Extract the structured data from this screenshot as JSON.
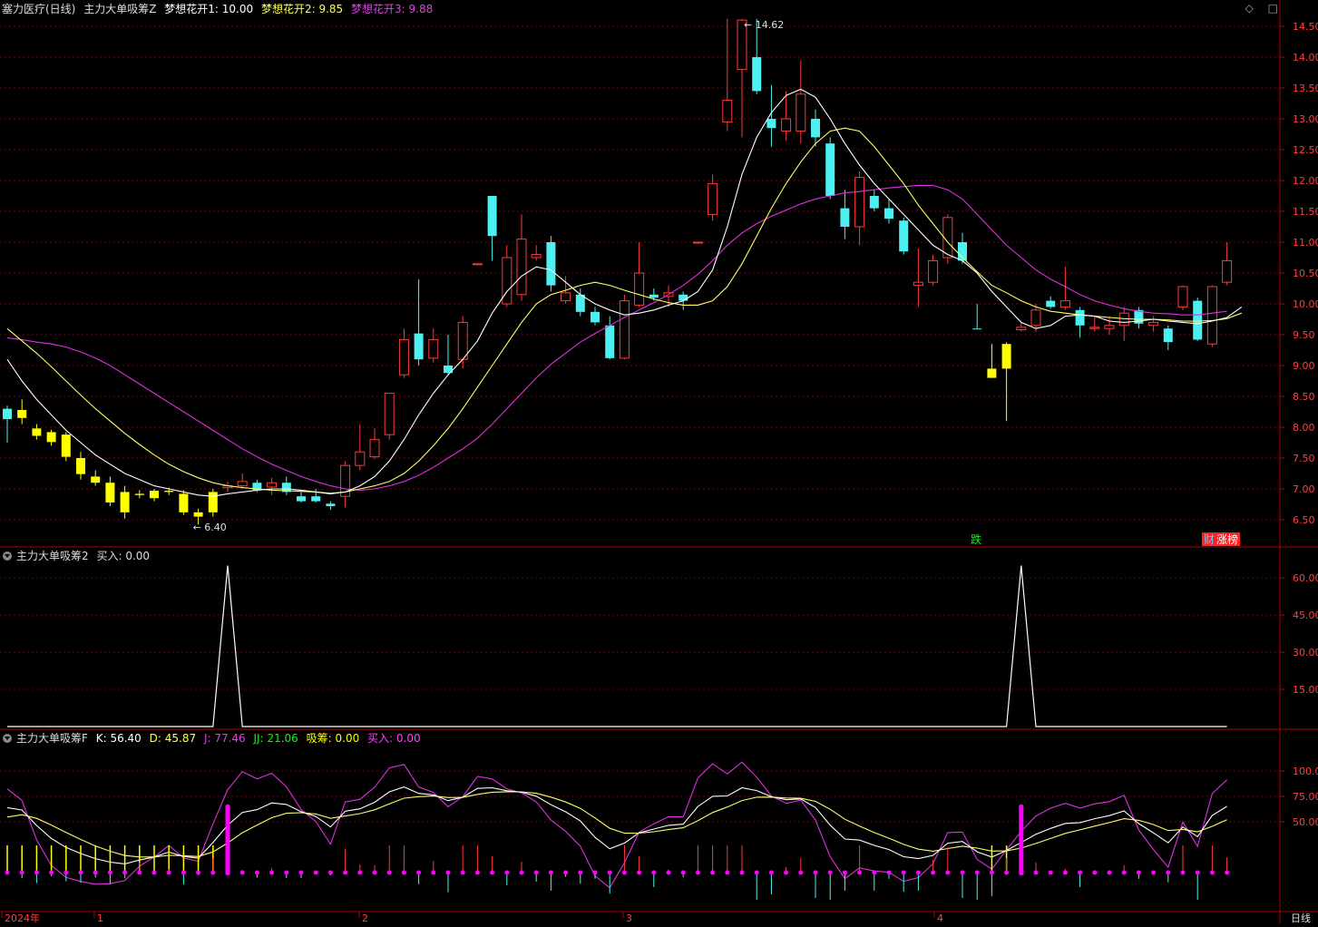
{
  "main_panel": {
    "stock_title": "塞力医疗(日线)",
    "indicator_name": "主力大单吸筹Z",
    "series1_label": "梦想花开1: 10.00",
    "series2_label": "梦想花开2: 9.85",
    "series3_label": "梦想花开3: 9.88",
    "high_label": "14.62",
    "low_label": "6.40",
    "marker_die": "跌",
    "marker_cai": "财",
    "marker_zhangting": "涨榜",
    "y_ticks": [
      "14.50",
      "14.00",
      "13.50",
      "13.00",
      "12.50",
      "12.00",
      "11.50",
      "11.00",
      "10.50",
      "10.00",
      "9.50",
      "9.00",
      "8.50",
      "8.00",
      "7.50",
      "7.00",
      "6.50"
    ]
  },
  "panel2": {
    "name": "主力大单吸筹2",
    "buy_label": "买入: 0.00",
    "y_ticks": [
      "60.00",
      "45.00",
      "30.00",
      "15.00"
    ]
  },
  "panel3": {
    "name": "主力大单吸筹F",
    "k_label": "K: 56.40",
    "d_label": "D: 45.87",
    "j_label": "J: 77.46",
    "jj_label": "JJ: 21.06",
    "xichou_label": "吸筹: 0.00",
    "buy_label": "买入: 0.00",
    "y_ticks": [
      "100.0",
      "75.00",
      "50.00"
    ]
  },
  "x_axis": {
    "labels": [
      "2024年",
      "1",
      "2",
      "3",
      "4"
    ],
    "period": "日线"
  },
  "colors": {
    "up": "#ff3a3a",
    "down": "#4cf0f0",
    "yellow_candle": "#ffff00",
    "ma_white": "#ffffff",
    "ma_yellow": "#ffff66",
    "ma_magenta": "#e030e0",
    "grid": "#7a0000",
    "axis": "#b00000",
    "magenta": "#ff00ff",
    "green_text": "#00ff00"
  },
  "chart_data": {
    "type": "candlestick",
    "price_range": [
      6.2,
      14.75
    ],
    "candles": [
      {
        "o": 8.13,
        "h": 8.35,
        "l": 7.75,
        "c": 8.3,
        "col": "down"
      },
      {
        "o": 8.28,
        "h": 8.45,
        "l": 8.05,
        "c": 8.15,
        "col": "yellow"
      },
      {
        "o": 7.98,
        "h": 8.05,
        "l": 7.8,
        "c": 7.86,
        "col": "yellow"
      },
      {
        "o": 7.92,
        "h": 7.96,
        "l": 7.7,
        "c": 7.76,
        "col": "yellow"
      },
      {
        "o": 7.88,
        "h": 7.92,
        "l": 7.45,
        "c": 7.52,
        "col": "yellow"
      },
      {
        "o": 7.5,
        "h": 7.6,
        "l": 7.15,
        "c": 7.24,
        "col": "yellow"
      },
      {
        "o": 7.2,
        "h": 7.3,
        "l": 7.05,
        "c": 7.1,
        "col": "yellow"
      },
      {
        "o": 7.1,
        "h": 7.2,
        "l": 6.72,
        "c": 6.78,
        "col": "yellow"
      },
      {
        "o": 6.95,
        "h": 7.05,
        "l": 6.52,
        "c": 6.62,
        "col": "yellow"
      },
      {
        "o": 6.92,
        "h": 6.98,
        "l": 6.85,
        "c": 6.9,
        "col": "yellow"
      },
      {
        "o": 6.97,
        "h": 7.0,
        "l": 6.8,
        "c": 6.85,
        "col": "yellow"
      },
      {
        "o": 6.97,
        "h": 7.02,
        "l": 6.9,
        "c": 6.95,
        "col": "yellow"
      },
      {
        "o": 6.92,
        "h": 6.98,
        "l": 6.58,
        "c": 6.62,
        "col": "yellow"
      },
      {
        "o": 6.62,
        "h": 6.68,
        "l": 6.42,
        "c": 6.55,
        "col": "yellow"
      },
      {
        "o": 6.62,
        "h": 7.0,
        "l": 6.55,
        "c": 6.95,
        "col": "yellow"
      },
      {
        "o": 7.02,
        "h": 7.12,
        "l": 6.95,
        "c": 7.05,
        "col": "up"
      },
      {
        "o": 7.05,
        "h": 7.25,
        "l": 7.0,
        "c": 7.12,
        "col": "up"
      },
      {
        "o": 7.1,
        "h": 7.15,
        "l": 6.95,
        "c": 6.98,
        "col": "down"
      },
      {
        "o": 7.03,
        "h": 7.18,
        "l": 6.9,
        "c": 7.1,
        "col": "up"
      },
      {
        "o": 7.1,
        "h": 7.2,
        "l": 6.9,
        "c": 6.95,
        "col": "down"
      },
      {
        "o": 6.88,
        "h": 6.95,
        "l": 6.78,
        "c": 6.8,
        "col": "down"
      },
      {
        "o": 6.88,
        "h": 7.0,
        "l": 6.78,
        "c": 6.8,
        "col": "down"
      },
      {
        "o": 6.76,
        "h": 6.8,
        "l": 6.66,
        "c": 6.72,
        "col": "down"
      },
      {
        "o": 6.88,
        "h": 7.45,
        "l": 6.7,
        "c": 7.38,
        "col": "up"
      },
      {
        "o": 7.38,
        "h": 8.05,
        "l": 7.3,
        "c": 7.6,
        "col": "up"
      },
      {
        "o": 7.52,
        "h": 7.98,
        "l": 7.48,
        "c": 7.8,
        "col": "up"
      },
      {
        "o": 7.88,
        "h": 8.55,
        "l": 7.8,
        "c": 8.55,
        "col": "up"
      },
      {
        "o": 8.85,
        "h": 9.6,
        "l": 8.8,
        "c": 9.42,
        "col": "up"
      },
      {
        "o": 9.52,
        "h": 10.4,
        "l": 9.0,
        "c": 9.1,
        "col": "down"
      },
      {
        "o": 9.12,
        "h": 9.6,
        "l": 9.05,
        "c": 9.42,
        "col": "up"
      },
      {
        "o": 9.0,
        "h": 9.5,
        "l": 8.85,
        "c": 8.88,
        "col": "down"
      },
      {
        "o": 9.1,
        "h": 9.8,
        "l": 8.95,
        "c": 9.7,
        "col": "up"
      },
      {
        "o": 10.65,
        "h": 10.65,
        "l": 10.65,
        "c": 10.65,
        "col": "up"
      },
      {
        "o": 11.75,
        "h": 11.75,
        "l": 10.7,
        "c": 11.1,
        "col": "down"
      },
      {
        "o": 10.0,
        "h": 10.95,
        "l": 9.95,
        "c": 10.75,
        "col": "up"
      },
      {
        "o": 10.15,
        "h": 11.45,
        "l": 10.05,
        "c": 11.05,
        "col": "up"
      },
      {
        "o": 10.75,
        "h": 10.95,
        "l": 10.7,
        "c": 10.8,
        "col": "up"
      },
      {
        "o": 11.0,
        "h": 11.1,
        "l": 10.2,
        "c": 10.3,
        "col": "down"
      },
      {
        "o": 10.05,
        "h": 10.45,
        "l": 10.0,
        "c": 10.18,
        "col": "up"
      },
      {
        "o": 10.15,
        "h": 10.25,
        "l": 9.8,
        "c": 9.87,
        "col": "down"
      },
      {
        "o": 9.87,
        "h": 9.95,
        "l": 9.65,
        "c": 9.7,
        "col": "down"
      },
      {
        "o": 9.65,
        "h": 9.8,
        "l": 9.1,
        "c": 9.12,
        "col": "down"
      },
      {
        "o": 9.12,
        "h": 10.15,
        "l": 9.1,
        "c": 10.05,
        "col": "up"
      },
      {
        "o": 9.98,
        "h": 11.0,
        "l": 9.95,
        "c": 10.5,
        "col": "up"
      },
      {
        "o": 10.15,
        "h": 10.25,
        "l": 10.05,
        "c": 10.1,
        "col": "down"
      },
      {
        "o": 10.12,
        "h": 10.3,
        "l": 9.95,
        "c": 10.18,
        "col": "up"
      },
      {
        "o": 10.15,
        "h": 10.2,
        "l": 9.9,
        "c": 10.05,
        "col": "down"
      },
      {
        "o": 11.0,
        "h": 11.0,
        "l": 11.0,
        "c": 11.0,
        "col": "up"
      },
      {
        "o": 11.45,
        "h": 12.1,
        "l": 11.35,
        "c": 11.95,
        "col": "up"
      },
      {
        "o": 12.95,
        "h": 14.62,
        "l": 12.8,
        "c": 13.3,
        "col": "up"
      },
      {
        "o": 13.8,
        "h": 14.62,
        "l": 12.7,
        "c": 14.6,
        "col": "up"
      },
      {
        "o": 14.0,
        "h": 14.62,
        "l": 13.4,
        "c": 13.45,
        "col": "down"
      },
      {
        "o": 13.0,
        "h": 13.55,
        "l": 12.55,
        "c": 12.85,
        "col": "down"
      },
      {
        "o": 12.8,
        "h": 13.45,
        "l": 12.65,
        "c": 13.0,
        "col": "up"
      },
      {
        "o": 12.8,
        "h": 13.95,
        "l": 12.6,
        "c": 13.4,
        "col": "up"
      },
      {
        "o": 13.0,
        "h": 13.15,
        "l": 12.55,
        "c": 12.7,
        "col": "down"
      },
      {
        "o": 12.6,
        "h": 12.7,
        "l": 11.7,
        "c": 11.75,
        "col": "down"
      },
      {
        "o": 11.55,
        "h": 11.85,
        "l": 11.05,
        "c": 11.25,
        "col": "down"
      },
      {
        "o": 11.25,
        "h": 12.15,
        "l": 10.95,
        "c": 12.05,
        "col": "up"
      },
      {
        "o": 11.75,
        "h": 11.85,
        "l": 11.5,
        "c": 11.55,
        "col": "down"
      },
      {
        "o": 11.55,
        "h": 11.7,
        "l": 11.3,
        "c": 11.38,
        "col": "down"
      },
      {
        "o": 11.35,
        "h": 11.4,
        "l": 10.8,
        "c": 10.85,
        "col": "down"
      },
      {
        "o": 10.3,
        "h": 10.9,
        "l": 9.95,
        "c": 10.35,
        "col": "up"
      },
      {
        "o": 10.35,
        "h": 10.8,
        "l": 10.3,
        "c": 10.7,
        "col": "up"
      },
      {
        "o": 10.75,
        "h": 11.45,
        "l": 10.65,
        "c": 11.4,
        "col": "up"
      },
      {
        "o": 11.0,
        "h": 11.15,
        "l": 10.65,
        "c": 10.7,
        "col": "down"
      },
      {
        "o": 9.6,
        "h": 10.0,
        "l": 9.6,
        "c": 9.6,
        "col": "down"
      },
      {
        "o": 8.8,
        "h": 9.35,
        "l": 8.8,
        "c": 8.95,
        "col": "yellow"
      },
      {
        "o": 8.95,
        "h": 9.38,
        "l": 8.1,
        "c": 9.35,
        "col": "yellow"
      },
      {
        "o": 9.58,
        "h": 9.7,
        "l": 9.55,
        "c": 9.62,
        "col": "up"
      },
      {
        "o": 9.65,
        "h": 10.0,
        "l": 9.55,
        "c": 9.9,
        "col": "up"
      },
      {
        "o": 10.05,
        "h": 10.12,
        "l": 9.92,
        "c": 9.95,
        "col": "down"
      },
      {
        "o": 9.95,
        "h": 10.6,
        "l": 9.9,
        "c": 10.05,
        "col": "up"
      },
      {
        "o": 9.9,
        "h": 9.95,
        "l": 9.45,
        "c": 9.65,
        "col": "down"
      },
      {
        "o": 9.6,
        "h": 9.8,
        "l": 9.55,
        "c": 9.62,
        "col": "up"
      },
      {
        "o": 9.6,
        "h": 9.8,
        "l": 9.5,
        "c": 9.65,
        "col": "up"
      },
      {
        "o": 9.65,
        "h": 9.95,
        "l": 9.4,
        "c": 9.85,
        "col": "up"
      },
      {
        "o": 9.9,
        "h": 9.95,
        "l": 9.6,
        "c": 9.68,
        "col": "down"
      },
      {
        "o": 9.7,
        "h": 9.8,
        "l": 9.55,
        "c": 9.65,
        "col": "up"
      },
      {
        "o": 9.6,
        "h": 9.65,
        "l": 9.25,
        "c": 9.38,
        "col": "down"
      },
      {
        "o": 9.95,
        "h": 10.3,
        "l": 9.9,
        "c": 10.28,
        "col": "up"
      },
      {
        "o": 10.05,
        "h": 10.1,
        "l": 9.4,
        "c": 9.42,
        "col": "down"
      },
      {
        "o": 9.35,
        "h": 10.3,
        "l": 9.3,
        "c": 10.28,
        "col": "up"
      },
      {
        "o": 10.35,
        "h": 11.0,
        "l": 10.3,
        "c": 10.7,
        "col": "up"
      }
    ],
    "ma_white": [
      9.1,
      8.75,
      8.45,
      8.2,
      7.95,
      7.75,
      7.55,
      7.4,
      7.25,
      7.15,
      7.05,
      7.0,
      6.95,
      6.9,
      6.88,
      6.92,
      6.95,
      6.98,
      7.0,
      7.0,
      6.98,
      6.95,
      6.92,
      6.95,
      7.05,
      7.2,
      7.45,
      7.8,
      8.2,
      8.55,
      8.85,
      9.1,
      9.4,
      9.85,
      10.2,
      10.45,
      10.6,
      10.55,
      10.35,
      10.15,
      10.0,
      9.9,
      9.82,
      9.85,
      9.9,
      9.98,
      10.05,
      10.2,
      10.55,
      11.25,
      12.1,
      12.7,
      13.1,
      13.38,
      13.48,
      13.35,
      13.0,
      12.6,
      12.25,
      11.95,
      11.7,
      11.45,
      11.2,
      10.95,
      10.8,
      10.7,
      10.5,
      10.2,
      9.95,
      9.7,
      9.6,
      9.65,
      9.8,
      9.82,
      9.8,
      9.72,
      9.7,
      9.72,
      9.75,
      9.72,
      9.7,
      9.68,
      9.72,
      9.78,
      9.95
    ],
    "ma_yellow": [
      9.6,
      9.4,
      9.2,
      8.98,
      8.75,
      8.52,
      8.3,
      8.1,
      7.9,
      7.72,
      7.55,
      7.4,
      7.28,
      7.18,
      7.1,
      7.05,
      7.02,
      7.0,
      6.98,
      6.97,
      6.96,
      6.95,
      6.93,
      6.95,
      7.0,
      7.05,
      7.12,
      7.25,
      7.45,
      7.7,
      7.98,
      8.3,
      8.65,
      9.0,
      9.35,
      9.7,
      10.0,
      10.15,
      10.22,
      10.3,
      10.35,
      10.3,
      10.22,
      10.15,
      10.08,
      10.02,
      9.98,
      9.98,
      10.05,
      10.28,
      10.65,
      11.1,
      11.55,
      11.95,
      12.3,
      12.6,
      12.8,
      12.85,
      12.8,
      12.55,
      12.25,
      11.95,
      11.6,
      11.3,
      11.0,
      10.75,
      10.52,
      10.3,
      10.18,
      10.05,
      9.95,
      9.88,
      9.85,
      9.82,
      9.8,
      9.78,
      9.76,
      9.75,
      9.75,
      9.74,
      9.72,
      9.72,
      9.73,
      9.76,
      9.85
    ],
    "ma_magenta": [
      9.45,
      9.42,
      9.38,
      9.35,
      9.3,
      9.22,
      9.12,
      9.0,
      8.85,
      8.7,
      8.55,
      8.4,
      8.25,
      8.1,
      7.95,
      7.8,
      7.65,
      7.52,
      7.4,
      7.3,
      7.2,
      7.12,
      7.05,
      7.0,
      6.98,
      7.0,
      7.05,
      7.12,
      7.22,
      7.35,
      7.5,
      7.65,
      7.82,
      8.05,
      8.3,
      8.55,
      8.8,
      9.02,
      9.2,
      9.38,
      9.52,
      9.65,
      9.78,
      9.9,
      10.02,
      10.15,
      10.3,
      10.48,
      10.7,
      10.95,
      11.15,
      11.3,
      11.42,
      11.52,
      11.62,
      11.7,
      11.75,
      11.8,
      11.82,
      11.85,
      11.88,
      11.9,
      11.92,
      11.92,
      11.85,
      11.7,
      11.45,
      11.2,
      10.95,
      10.75,
      10.55,
      10.4,
      10.28,
      10.15,
      10.05,
      9.98,
      9.92,
      9.88,
      9.85,
      9.84,
      9.82,
      9.82,
      9.85,
      9.88
    ]
  }
}
